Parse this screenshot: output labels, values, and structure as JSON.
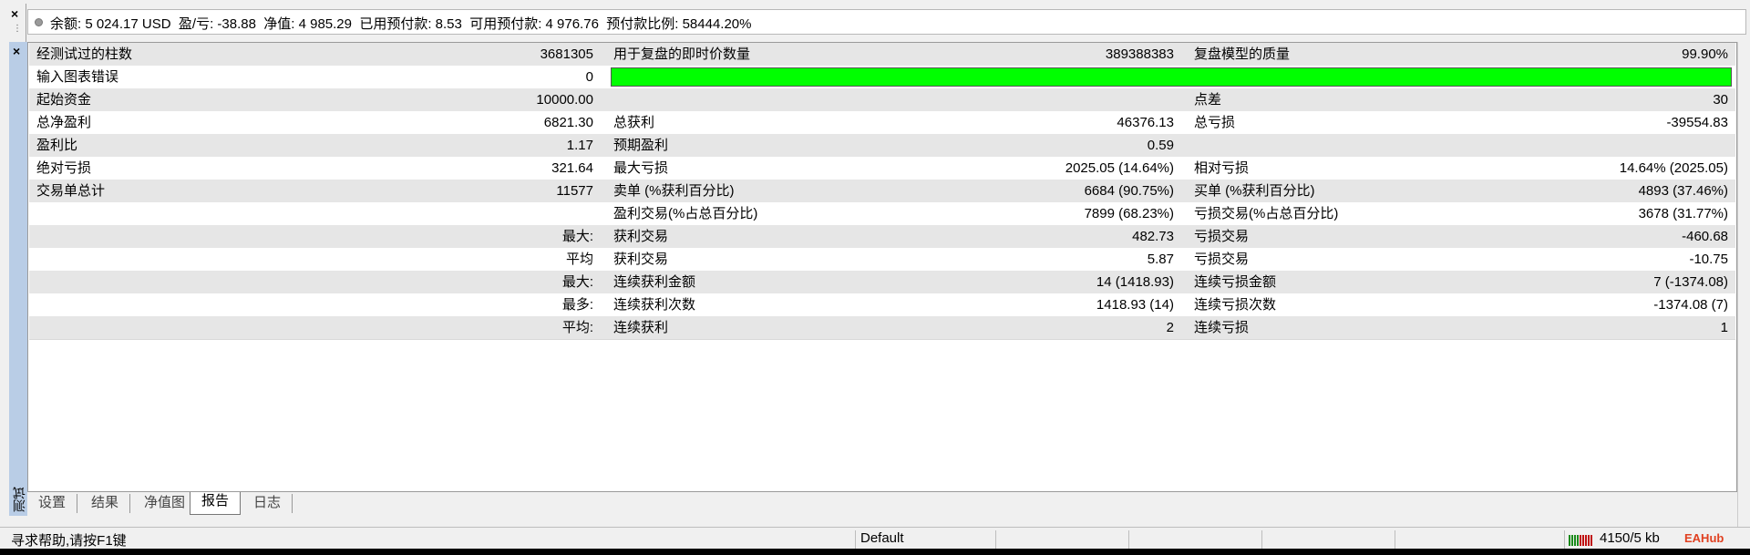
{
  "account": {
    "text": "余额: 5 024.17 USD  盈/亏: -38.88  净值: 4 985.29  已用预付款: 8.53  可用预付款: 4 976.76  预付款比例: 58444.20%"
  },
  "panel": {
    "vertical_tab_label": "测试"
  },
  "report": {
    "rows": [
      {
        "l1": "经测试过的柱数",
        "v1": "3681305",
        "l2": "用于复盘的即时价数量",
        "v2": "389388383",
        "l3": "复盘模型的质量",
        "v3": "99.90%"
      },
      {
        "l1": "输入图表错误",
        "v1": "0",
        "l2": "",
        "v2": "",
        "l3": "",
        "v3": ""
      },
      {
        "l1": "起始资金",
        "v1": "10000.00",
        "l2": "",
        "v2": "",
        "l3": "点差",
        "v3": "30"
      },
      {
        "l1": "总净盈利",
        "v1": "6821.30",
        "l2": "总获利",
        "v2": "46376.13",
        "l3": "总亏损",
        "v3": "-39554.83"
      },
      {
        "l1": "盈利比",
        "v1": "1.17",
        "l2": "预期盈利",
        "v2": "0.59",
        "l3": "",
        "v3": ""
      },
      {
        "l1": "绝对亏损",
        "v1": "321.64",
        "l2": "最大亏损",
        "v2": "2025.05 (14.64%)",
        "l3": "相对亏损",
        "v3": "14.64% (2025.05)"
      },
      {
        "l1": "交易单总计",
        "v1": "11577",
        "l2": "卖单 (%获利百分比)",
        "v2": "6684 (90.75%)",
        "l3": "买单 (%获利百分比)",
        "v3": "4893 (37.46%)"
      },
      {
        "l1": "",
        "v1": "",
        "l2": "盈利交易(%占总百分比)",
        "v2": "7899 (68.23%)",
        "l3": "亏损交易(%占总百分比)",
        "v3": "3678 (31.77%)"
      },
      {
        "l1": "",
        "v1": "最大:",
        "l2": "获利交易",
        "v2": "482.73",
        "l3": "亏损交易",
        "v3": "-460.68"
      },
      {
        "l1": "",
        "v1": "平均",
        "l2": "获利交易",
        "v2": "5.87",
        "l3": "亏损交易",
        "v3": "-10.75"
      },
      {
        "l1": "",
        "v1": "最大:",
        "l2": "连续获利金额",
        "v2": "14 (1418.93)",
        "l3": "连续亏损金额",
        "v3": "7 (-1374.08)"
      },
      {
        "l1": "",
        "v1": "最多:",
        "l2": "连续获利次数",
        "v2": "1418.93 (14)",
        "l3": "连续亏损次数",
        "v3": "-1374.08 (7)"
      },
      {
        "l1": "",
        "v1": "平均:",
        "l2": "连续获利",
        "v2": "2",
        "l3": "连续亏损",
        "v3": "1"
      }
    ],
    "quality_fill_fraction": 1.0,
    "quality_bar_color": "#00ff00"
  },
  "tabs": [
    {
      "label": "设置"
    },
    {
      "label": "结果"
    },
    {
      "label": "净值图"
    },
    {
      "label": "报告"
    },
    {
      "label": "日志"
    }
  ],
  "active_tab": "报告",
  "status": {
    "help": "寻求帮助,请按F1键",
    "profile": "Default",
    "traffic": "4150/5 kb",
    "watermark": "EAHub"
  }
}
